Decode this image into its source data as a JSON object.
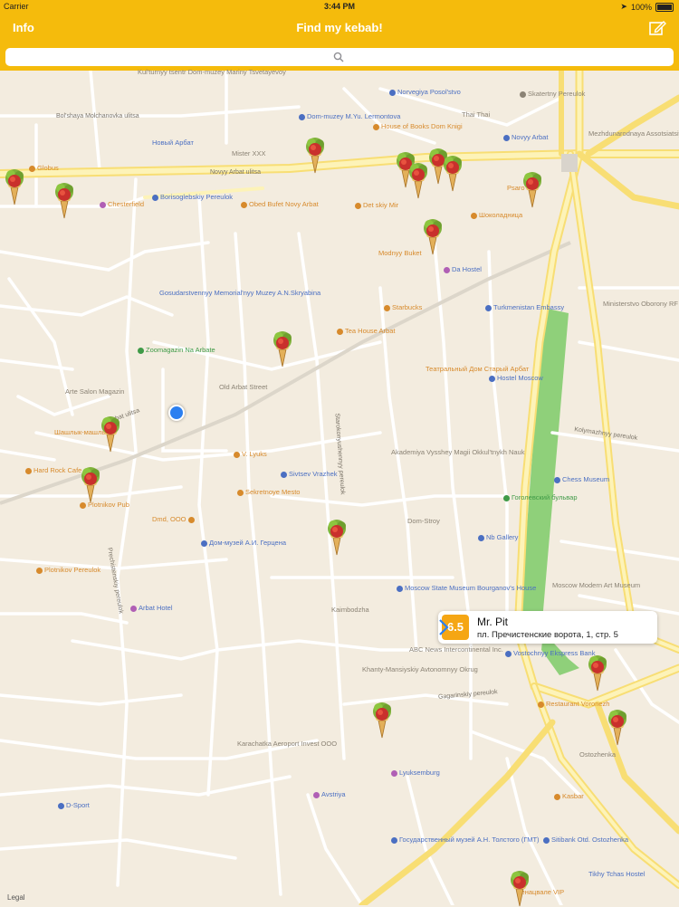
{
  "status_bar": {
    "carrier": "Carrier",
    "time": "3:44 PM",
    "battery": "100%"
  },
  "nav": {
    "info_label": "Info",
    "title": "Find my kebab!",
    "compose_icon": "compose-icon"
  },
  "search": {
    "value": "",
    "placeholder": "",
    "icon": "search-icon"
  },
  "colors": {
    "accent": "#f5bb0c",
    "score_badge": "#f5a614",
    "user_location": "#2b7ff0",
    "map_background": "#f3ecdf",
    "park": "#8fd07a"
  },
  "map": {
    "legal": "Legal",
    "streets": [
      {
        "label": "Bol'shaya Molchanovka ulitsa"
      },
      {
        "label": "Novyy Arbat ulitsa"
      },
      {
        "label": "Arbat ulitsa"
      },
      {
        "label": "Gagarinskiy pereulok"
      },
      {
        "label": "Kolymazhnyy pereulok"
      },
      {
        "label": "Prechistenskiy pereulok"
      },
      {
        "label": "Starokonyushennyy pereulok"
      },
      {
        "label": "Sivtsev Vrazhek"
      }
    ],
    "pois": [
      {
        "label": "Kul'turnyy tsentr Dom-muzey Mariny Tsvetayevoy",
        "color": "gray"
      },
      {
        "label": "Dom-muzey M.Yu. Lermontova",
        "color": "blue"
      },
      {
        "label": "House of Books Dom Knigi",
        "color": "orange"
      },
      {
        "label": "Norvegiya Posol'stvo",
        "color": "blue"
      },
      {
        "label": "Thai Thai",
        "color": "gray"
      },
      {
        "label": "Skatertny Pereulok",
        "color": "gray"
      },
      {
        "label": "Novyy Arbat",
        "color": "blue"
      },
      {
        "label": "Mister XXX",
        "color": "gray"
      },
      {
        "label": "Новый Арбат",
        "color": "blue"
      },
      {
        "label": "Mezhdunarodnaya Assotsiatsiya Yuristov",
        "color": "gray"
      },
      {
        "label": "Globus",
        "color": "orange"
      },
      {
        "label": "Borisoglebskiy Pereulok",
        "color": "blue"
      },
      {
        "label": "Chesterfield",
        "color": "orange"
      },
      {
        "label": "Obed Bufet Novy Arbat",
        "color": "orange"
      },
      {
        "label": "Det skiy Mir",
        "color": "orange"
      },
      {
        "label": "Шоколадница",
        "color": "orange"
      },
      {
        "label": "Modnyy Buket",
        "color": "orange"
      },
      {
        "label": "Da Hostel",
        "color": "blue"
      },
      {
        "label": "Gosudarstvennyy Memorial'nyy Muzey A.N.Skryabina",
        "color": "blue"
      },
      {
        "label": "Starbucks",
        "color": "orange"
      },
      {
        "label": "Turkmenistan Embassy",
        "color": "blue"
      },
      {
        "label": "Ministerstvo Oborony RF",
        "color": "gray"
      },
      {
        "label": "Tea House Arbat",
        "color": "orange"
      },
      {
        "label": "Zoomagazin Na Arbate",
        "color": "green"
      },
      {
        "label": "Театральный Дом Старый Арбат",
        "color": "orange"
      },
      {
        "label": "Hostel Moscow",
        "color": "blue"
      },
      {
        "label": "Old Arbat Street",
        "color": "gray"
      },
      {
        "label": "Arte Salon Magazin",
        "color": "gray"
      },
      {
        "label": "Шашлык-машлык",
        "color": "orange"
      },
      {
        "label": "V. Lyuks",
        "color": "orange"
      },
      {
        "label": "Akademiya Vysshey Magii Okkul'tnykh Nauk",
        "color": "gray"
      },
      {
        "label": "Chess Museum",
        "color": "blue"
      },
      {
        "label": "Hard Rock Cafe",
        "color": "orange"
      },
      {
        "label": "Plotnikov Pub",
        "color": "orange"
      },
      {
        "label": "Sivtsev Vrazhek",
        "color": "blue"
      },
      {
        "label": "Sekretnoye Mesto",
        "color": "orange"
      },
      {
        "label": "Гоголевский бульвар",
        "color": "green"
      },
      {
        "label": "Dmd, OOO",
        "color": "orange"
      },
      {
        "label": "Dom-Stroy",
        "color": "gray"
      },
      {
        "label": "Дом-музей А.И. Герцена",
        "color": "blue"
      },
      {
        "label": "Nb Gallery",
        "color": "blue"
      },
      {
        "label": "Plotnikov Pereulok",
        "color": "orange"
      },
      {
        "label": "Moscow State Museum Bourganov's House",
        "color": "blue"
      },
      {
        "label": "Moscow Modern Art Museum",
        "color": "gray"
      },
      {
        "label": "Arbat Hotel",
        "color": "blue"
      },
      {
        "label": "Kaimbodzha",
        "color": "gray"
      },
      {
        "label": "ABC News Intercontinental Inc.",
        "color": "gray"
      },
      {
        "label": "Vostochnyy Ekspress Bank",
        "color": "blue"
      },
      {
        "label": "Restaurant Voronezh",
        "color": "orange"
      },
      {
        "label": "Khanty-Mansiyskiy Avtonomnyy Okrug",
        "color": "gray"
      },
      {
        "label": "Karachatka Aeroport Invest OOO",
        "color": "gray"
      },
      {
        "label": "Lyuksemburg",
        "color": "blue"
      },
      {
        "label": "Avstriya",
        "color": "blue"
      },
      {
        "label": "D-Sport",
        "color": "blue"
      },
      {
        "label": "Ostozhenka",
        "color": "gray"
      },
      {
        "label": "Kasbar",
        "color": "orange"
      },
      {
        "label": "Государственный музей А.Н. Толстого (ГМТ)",
        "color": "blue"
      },
      {
        "label": "Sitibank Otd. Ostozhenka",
        "color": "blue"
      },
      {
        "label": "Tikhy Tchas Hostel",
        "color": "blue"
      },
      {
        "label": "Генацвале VIP",
        "color": "orange"
      },
      {
        "label": "Psaro",
        "color": "orange"
      }
    ],
    "selected_place": {
      "score": "6.5",
      "name": "Mr. Pit",
      "address": "пл. Пречистенские ворота, 1, стр. 5"
    }
  }
}
